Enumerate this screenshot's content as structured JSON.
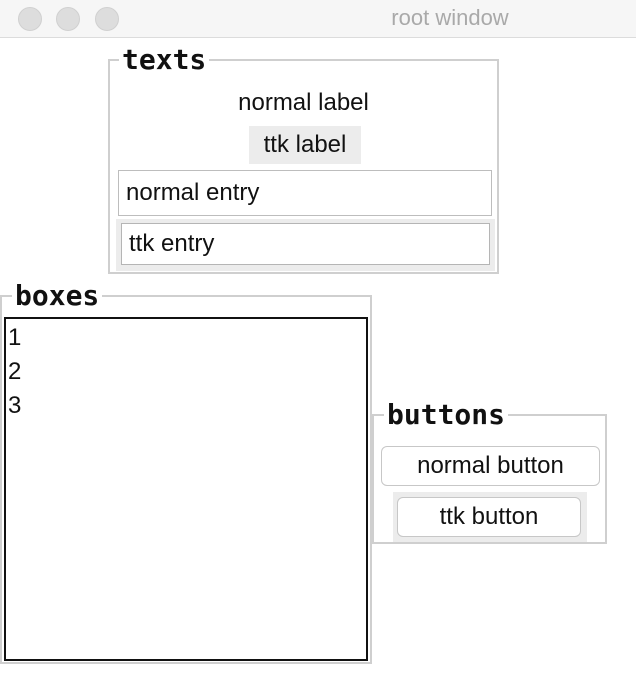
{
  "window": {
    "title": "root window"
  },
  "texts_frame": {
    "title": "texts",
    "normal_label": "normal label",
    "ttk_label": "ttk label",
    "normal_entry_value": "normal entry",
    "ttk_entry_value": "ttk entry"
  },
  "boxes_frame": {
    "title": "boxes",
    "items": [
      "1",
      "2",
      "3"
    ]
  },
  "buttons_frame": {
    "title": "buttons",
    "normal_button_label": "normal button",
    "ttk_button_label": "ttk button"
  },
  "icons": {
    "close": "close-dot-icon",
    "minimize": "minimize-dot-icon",
    "zoom": "zoom-dot-icon"
  },
  "colors": {
    "traffic_inactive": "#dddddd",
    "ttk_background": "#ececec",
    "frame_border": "#cfcfcf"
  }
}
